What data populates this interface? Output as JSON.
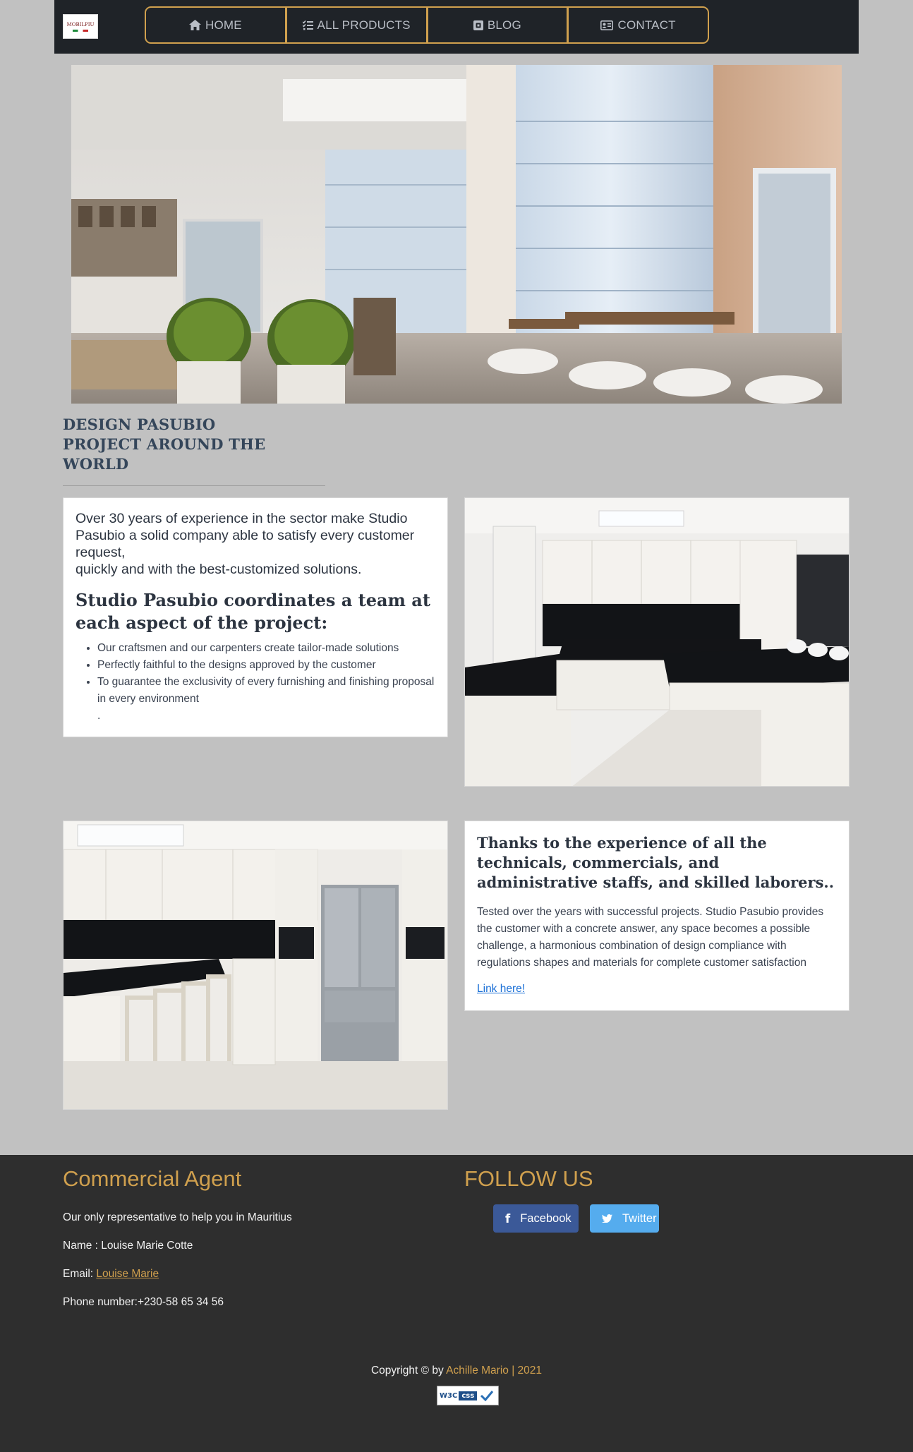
{
  "brand": {
    "logo_text": "MOBILPIU"
  },
  "nav": {
    "items": [
      {
        "label": "HOME",
        "icon": "home-icon"
      },
      {
        "label": "ALL PRODUCTS",
        "icon": "checklist-icon"
      },
      {
        "label": "BLOG",
        "icon": "blog-icon"
      },
      {
        "label": "CONTACT",
        "icon": "contact-card-icon"
      }
    ]
  },
  "section": {
    "title": "DESIGN PASUBIO PROJECT AROUND THE WORLD"
  },
  "intro_card": {
    "lead": "Over 30 years of experience in the sector make Studio Pasubio a solid company able to satisfy every customer request,",
    "lead2": "quickly and with the best-customized solutions.",
    "heading": "Studio Pasubio coordinates a team at each aspect of the project:",
    "bullets": [
      "Our craftsmen and our carpenters create tailor-made solutions",
      "Perfectly faithful to the designs approved by the customer",
      "To guarantee the exclusivity of every furnishing and finishing proposal in every environment"
    ],
    "trailing": "."
  },
  "experience_card": {
    "heading": "Thanks to the experience of all the technicals, commercials, and administrative staffs, and skilled laborers..",
    "body": "Tested over the years with successful projects. Studio Pasubio provides the customer with a concrete answer, any space becomes a possible challenge, a harmonious combination of design compliance with regulations shapes and materials for complete customer satisfaction",
    "link": "Link here!"
  },
  "footer": {
    "agent_heading": "Commercial Agent",
    "agent_intro": "Our only representative to help you in Mauritius",
    "agent_name": "Name : Louise Marie Cotte",
    "email_label": "Email: ",
    "email_link": "Louise Marie",
    "phone": "Phone number:+230-58 65 34 56",
    "follow_heading": "FOLLOW US",
    "facebook": "Facebook",
    "twitter": "Twitter",
    "copyright_prefix": "Copyright © by ",
    "copyright_author": "Achille Mario | 2021",
    "badge_w3": "W3C",
    "badge_css": "css"
  },
  "colors": {
    "accent": "#d0a04e",
    "navbar": "#1f2328",
    "page_bg": "#c1c1c1",
    "footer_bg": "#2e2e2e",
    "facebook": "#3b5998",
    "twitter": "#55acee"
  }
}
